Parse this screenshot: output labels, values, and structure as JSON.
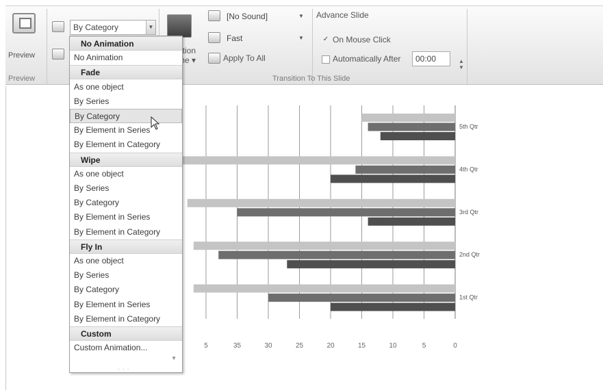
{
  "ribbon": {
    "preview_label": "Preview",
    "preview_group_label": "Preview",
    "animate_combo_value": "By Category",
    "transition_partial_label_1": "ation",
    "transition_partial_label_2": "me ▾",
    "sound_combo_value": "[No Sound]",
    "speed_combo_value": "Fast",
    "apply_to_all_label": "Apply To All",
    "advance_slide_label": "Advance Slide",
    "on_mouse_click_label": "On Mouse Click",
    "on_mouse_click_checked": true,
    "automatically_after_label": "Automatically After",
    "automatically_after_value": "00:00",
    "transition_group_label": "Transition To This Slide"
  },
  "dropdown": {
    "items": [
      {
        "label": "No Animation",
        "type": "header"
      },
      {
        "label": "No Animation",
        "type": "item"
      },
      {
        "label": "Fade",
        "type": "header"
      },
      {
        "label": "As one object",
        "type": "item"
      },
      {
        "label": "By Series",
        "type": "item"
      },
      {
        "label": "By Category",
        "type": "item",
        "selected": true
      },
      {
        "label": "By Element in Series",
        "type": "item"
      },
      {
        "label": "By Element in Category",
        "type": "item"
      },
      {
        "label": "Wipe",
        "type": "header"
      },
      {
        "label": "As one object",
        "type": "item"
      },
      {
        "label": "By Series",
        "type": "item"
      },
      {
        "label": "By Category",
        "type": "item"
      },
      {
        "label": "By Element in Series",
        "type": "item"
      },
      {
        "label": "By Element in Category",
        "type": "item"
      },
      {
        "label": "Fly In",
        "type": "header"
      },
      {
        "label": "As one object",
        "type": "item"
      },
      {
        "label": "By Series",
        "type": "item"
      },
      {
        "label": "By Category",
        "type": "item"
      },
      {
        "label": "By Element in Series",
        "type": "item"
      },
      {
        "label": "By Element in Category",
        "type": "item"
      },
      {
        "label": "Custom",
        "type": "header"
      },
      {
        "label": "Custom Animation...",
        "type": "item"
      }
    ]
  },
  "chart_data": {
    "type": "bar",
    "orientation": "horizontal",
    "x_reversed": true,
    "categories": [
      "1st Qtr",
      "2nd Qtr",
      "3rd Qtr",
      "4th Qtr",
      "5th Qtr"
    ],
    "series": [
      {
        "color": "#c4c4c4",
        "values": [
          42,
          42,
          43,
          45,
          15
        ]
      },
      {
        "color": "#6e6e6e",
        "values": [
          30,
          38,
          35,
          16,
          14
        ]
      },
      {
        "color": "#4f4f4f",
        "values": [
          20,
          27,
          14,
          20,
          12
        ]
      }
    ],
    "x_ticks": [
      "5",
      "35",
      "30",
      "25",
      "20",
      "15",
      "10",
      "5",
      "0"
    ],
    "x_tick_values": [
      40,
      35,
      30,
      25,
      20,
      15,
      10,
      5,
      0
    ],
    "xlim": [
      0,
      40
    ],
    "grid": true
  }
}
